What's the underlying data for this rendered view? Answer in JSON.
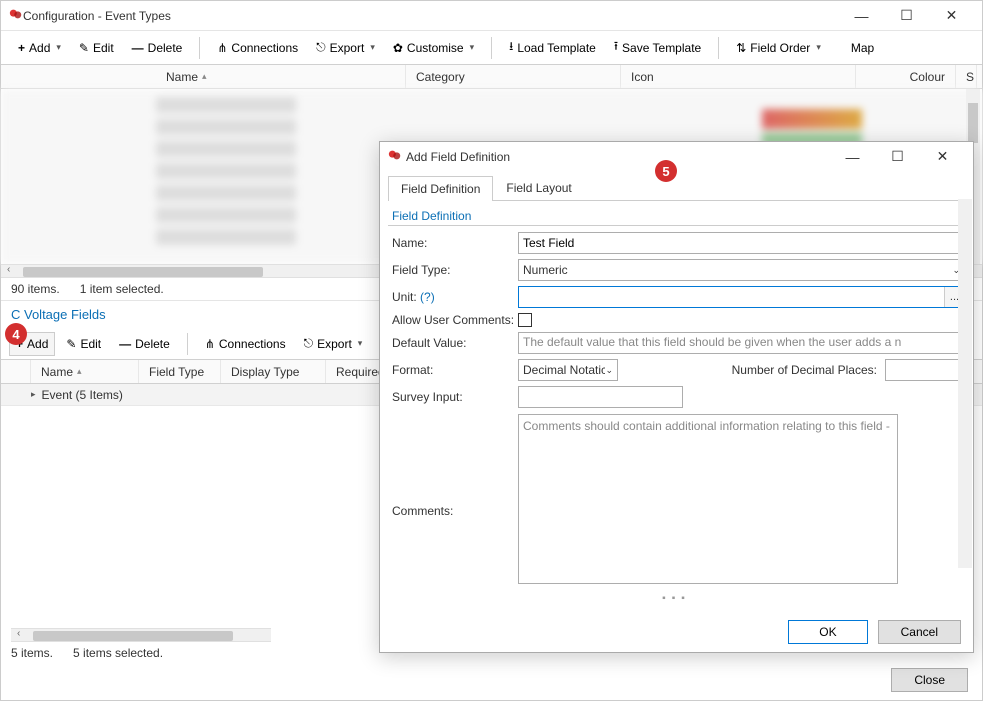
{
  "window": {
    "title": "Configuration - Event Types"
  },
  "toolbar": {
    "add": "Add",
    "edit": "Edit",
    "delete": "Delete",
    "connections": "Connections",
    "export": "Export",
    "customise": "Customise",
    "load_template": "Load Template",
    "save_template": "Save Template",
    "field_order": "Field Order",
    "map": "Map"
  },
  "columns": {
    "name": "Name",
    "category": "Category",
    "icon": "Icon",
    "colour": "Colour",
    "s": "S"
  },
  "status1": {
    "count": "90 items.",
    "selected": "1 item selected."
  },
  "section": {
    "title": "C Voltage Fields"
  },
  "toolbar2": {
    "add": "Add",
    "edit": "Edit",
    "delete": "Delete",
    "connections": "Connections",
    "export": "Export"
  },
  "columns2": {
    "name": "Name",
    "field_type": "Field Type",
    "display_type": "Display Type",
    "required": "Required"
  },
  "tree": {
    "item": "Event (5 Items)"
  },
  "status2": {
    "count": "5 items.",
    "selected": "5 items selected."
  },
  "close_btn": "Close",
  "modal": {
    "title": "Add Field Definition",
    "tabs": {
      "definition": "Field Definition",
      "layout": "Field Layout"
    },
    "group": "Field Definition",
    "labels": {
      "name": "Name:",
      "field_type": "Field Type:",
      "unit": "Unit:",
      "unit_help": "(?)",
      "allow_comments": "Allow User Comments:",
      "default_value": "Default Value:",
      "format": "Format:",
      "decimal_places": "Number of Decimal Places:",
      "survey_input": "Survey Input:",
      "comments": "Comments:"
    },
    "values": {
      "name": "Test Field",
      "field_type": "Numeric",
      "format": "Decimal Notatic",
      "default_placeholder": "The default value that this field should be given when the user adds a n",
      "comments_placeholder": "Comments should contain additional information relating to this field -"
    },
    "buttons": {
      "ok": "OK",
      "cancel": "Cancel"
    },
    "unit_browse": "..."
  },
  "callouts": {
    "c4": "4",
    "c5": "5"
  }
}
